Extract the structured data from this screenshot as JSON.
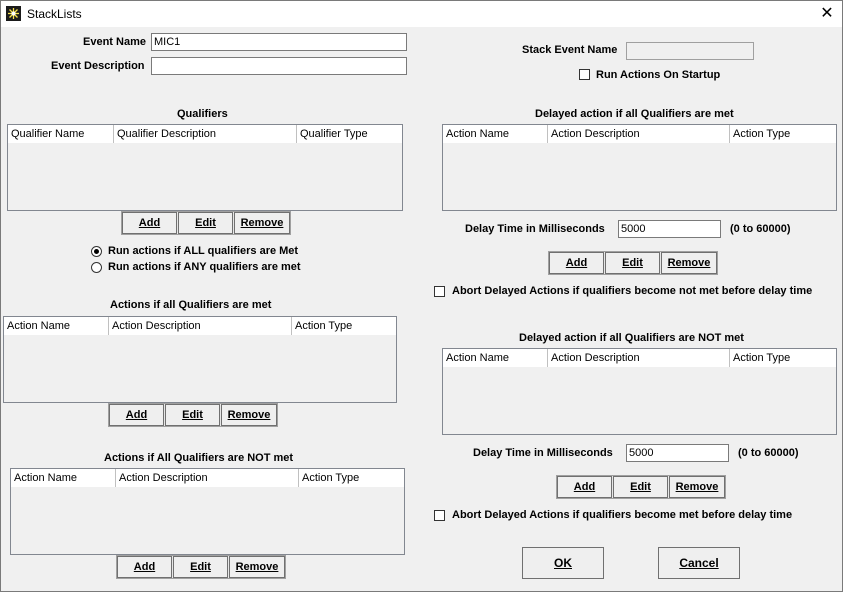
{
  "window": {
    "title": "StackLists",
    "close_glyph": "✕"
  },
  "event_name": {
    "label": "Event Name",
    "value": "MIC1"
  },
  "event_description": {
    "label": "Event Description",
    "value": ""
  },
  "stack_event_name": {
    "label": "Stack Event Name",
    "value": ""
  },
  "run_on_startup": {
    "label": "Run Actions On Startup",
    "checked": false
  },
  "qualifiers": {
    "title": "Qualifiers",
    "columns": [
      "Qualifier Name",
      "Qualifier Description",
      "Qualifier Type"
    ],
    "rows": [],
    "add": "Add",
    "edit": "Edit",
    "remove": "Remove"
  },
  "qualifier_mode": {
    "all_label": "Run actions if ALL qualifiers are Met",
    "any_label": "Run actions if ANY qualifiers are met",
    "selected": "all"
  },
  "actions_met": {
    "title": "Actions if all Qualifiers are met",
    "columns": [
      "Action Name",
      "Action Description",
      "Action Type"
    ],
    "rows": [],
    "add": "Add",
    "edit": "Edit",
    "remove": "Remove"
  },
  "actions_not_met": {
    "title": "Actions if All Qualifiers are NOT met",
    "columns": [
      "Action Name",
      "Action Description",
      "Action Type"
    ],
    "rows": [],
    "add": "Add",
    "edit": "Edit",
    "remove": "Remove"
  },
  "delayed_met": {
    "title": "Delayed action if all Qualifiers are met",
    "columns": [
      "Action Name",
      "Action Description",
      "Action Type"
    ],
    "rows": [],
    "delay_label": "Delay Time in Milliseconds",
    "delay_value": "5000",
    "range_hint": "(0 to 60000)",
    "add": "Add",
    "edit": "Edit",
    "remove": "Remove",
    "abort_label": "Abort Delayed Actions if qualifiers become not met before delay time",
    "abort_checked": false
  },
  "delayed_not_met": {
    "title": "Delayed action if all Qualifiers are NOT met",
    "columns": [
      "Action Name",
      "Action Description",
      "Action Type"
    ],
    "rows": [],
    "delay_label": "Delay Time in Milliseconds",
    "delay_value": "5000",
    "range_hint": "(0 to 60000)",
    "add": "Add",
    "edit": "Edit",
    "remove": "Remove",
    "abort_label": "Abort Delayed Actions if qualifiers become met before delay time",
    "abort_checked": false
  },
  "ok_label": "OK",
  "cancel_label": "Cancel"
}
